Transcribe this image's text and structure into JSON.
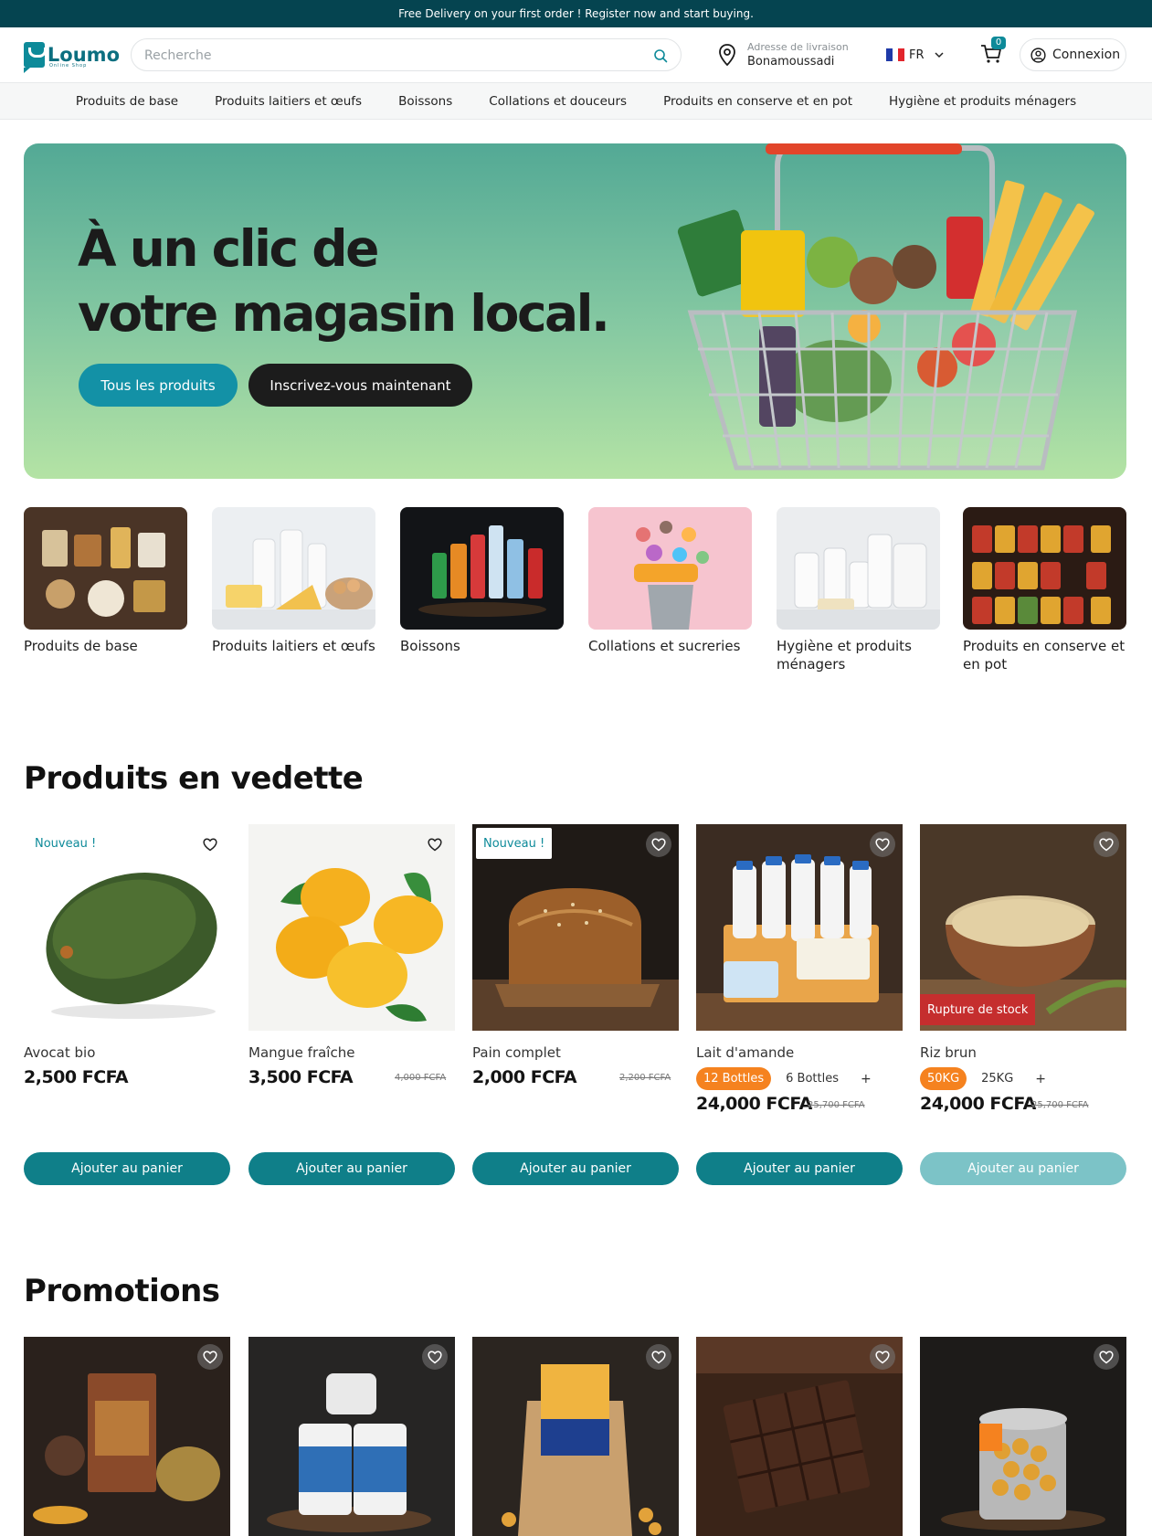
{
  "announcement": "Free Delivery on your first order ! Register now and start buying.",
  "brand": {
    "name": "Loumo",
    "tagline": "Online Shop"
  },
  "search": {
    "placeholder": "Recherche"
  },
  "delivery": {
    "label": "Adresse de livraison",
    "value": "Bonamoussadi"
  },
  "language": {
    "code": "FR"
  },
  "cart": {
    "count": "0"
  },
  "login": {
    "label": "Connexion"
  },
  "nav": [
    "Produits de base",
    "Produits laitiers et œufs",
    "Boissons",
    "Collations et douceurs",
    "Produits en conserve et en pot",
    "Hygiène et produits ménagers"
  ],
  "hero": {
    "title_line1": "À un clic de",
    "title_line2": "votre magasin local.",
    "cta_primary": "Tous les produits",
    "cta_secondary": "Inscrivez-vous maintenant"
  },
  "categories": [
    "Produits de base",
    "Produits laitiers et œufs",
    "Boissons",
    "Collations et sucreries",
    "Hygiène et produits ménagers",
    "Produits en conserve et en pot"
  ],
  "featured": {
    "title": "Produits en vedette",
    "add_label": "Ajouter au panier",
    "new_label": "Nouveau !",
    "oos_label": "Rupture de stock",
    "products": [
      {
        "name": "Avocat bio",
        "price": "2,500 FCFA"
      },
      {
        "name": "Mangue fraîche",
        "price": "3,500 FCFA",
        "old_price": "4,000 FCFA"
      },
      {
        "name": "Pain complet",
        "price": "2,000 FCFA",
        "old_price": "2,200 FCFA"
      },
      {
        "name": "Lait d'amande",
        "variant_selected": "12 Bottles",
        "variant_other": "6 Bottles",
        "plus": "+",
        "price": "24,000 FCFA",
        "old_price": "25,700 FCFA"
      },
      {
        "name": "Riz brun",
        "variant_selected": "50KG",
        "variant_other": "25KG",
        "plus": "+",
        "price": "24,000 FCFA",
        "old_price": "25,700 FCFA"
      }
    ]
  },
  "promotions": {
    "title": "Promotions"
  },
  "colors": {
    "accent": "#0f7f89",
    "topbar": "#054450",
    "badge_orange": "#f5821f",
    "out_of_stock": "#c52e2e"
  }
}
